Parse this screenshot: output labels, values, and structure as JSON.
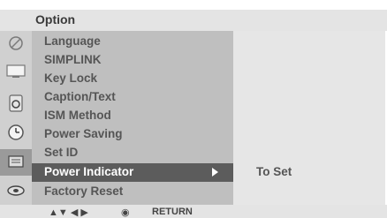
{
  "header": {
    "title": "Option"
  },
  "menu": {
    "items": [
      {
        "label": "Language"
      },
      {
        "label": "SIMPLINK"
      },
      {
        "label": "Key Lock"
      },
      {
        "label": "Caption/Text"
      },
      {
        "label": "ISM Method"
      },
      {
        "label": "Power Saving"
      },
      {
        "label": "Set ID"
      },
      {
        "label": "Power Indicator",
        "selected": true
      },
      {
        "label": "Factory Reset"
      }
    ]
  },
  "submenu": {
    "value": "To Set"
  },
  "footer": {
    "nav_symbol": "▲▼  ◀ ▶",
    "ok_symbol": "◉",
    "return_label": "RETURN"
  },
  "icons": [
    "satellite-icon",
    "tv-screen-icon",
    "speaker-icon",
    "clock-icon",
    "tv-grid-icon",
    "option-disc-icon"
  ],
  "colors": {
    "selected_bg": "#5c5c5c",
    "panel_bg": "#bfbfbf",
    "header_bg": "#e4e4e4"
  }
}
